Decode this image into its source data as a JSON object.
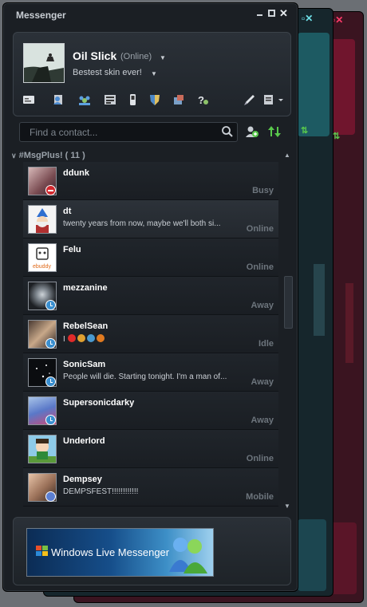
{
  "window": {
    "title": "Messenger"
  },
  "profile": {
    "name": "Oil Slick",
    "status": "(Online)",
    "personal_message": "Bestest skin ever!"
  },
  "search": {
    "placeholder": "Find a contact..."
  },
  "group": {
    "label": "#MsgPlus! ( 11 )"
  },
  "contacts": [
    {
      "name": "ddunk",
      "message": "",
      "status": "Busy",
      "badge": "busy"
    },
    {
      "name": "dt",
      "message": "twenty years from now, maybe we'll both si...",
      "status": "Online",
      "badge": ""
    },
    {
      "name": "Felu",
      "message": "",
      "status": "Online",
      "badge": ""
    },
    {
      "name": "mezzanine",
      "message": "",
      "status": "Away",
      "badge": "away"
    },
    {
      "name": "RebelSean",
      "message": "I",
      "status": "Idle",
      "badge": "away"
    },
    {
      "name": "SonicSam",
      "message": "People will die. Starting tonight. I'm a man of...",
      "status": "Away",
      "badge": "away"
    },
    {
      "name": "Supersonicdarky",
      "message": "",
      "status": "Away",
      "badge": "away"
    },
    {
      "name": "Underlord",
      "message": "",
      "status": "Online",
      "badge": ""
    },
    {
      "name": "Dempsey",
      "message": "DEMPSFEST!!!!!!!!!!!!",
      "status": "Mobile",
      "badge": "mobile"
    }
  ],
  "ad": {
    "text": "Windows Live Messenger"
  },
  "icons": {
    "toolbar": [
      "contact-card-icon",
      "contacts-icon",
      "groups-icon",
      "inbox-icon",
      "mobile-icon",
      "shield-icon",
      "packages-icon",
      "help-icon",
      "paint-icon",
      "menu-icon"
    ],
    "add_contact": "add-contact-icon",
    "sort": "sort-icon",
    "search": "search-icon"
  },
  "colors": {
    "window_bg": "#1b1f24",
    "busy": "#d2282e",
    "away": "#3a8fd0"
  }
}
